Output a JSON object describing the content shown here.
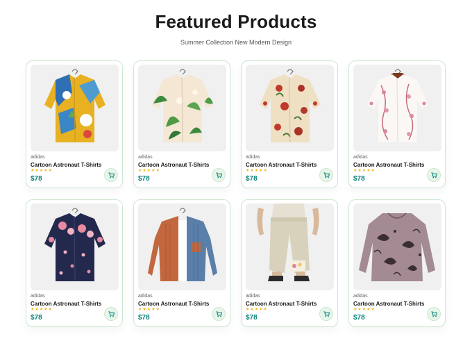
{
  "header": {
    "title": "Featured Products",
    "subtitle": "Summer Collection New Modern Design"
  },
  "products": [
    {
      "brand": "adidas",
      "name": "Cartoon Astronaut T-Shirts",
      "stars": "★★★★★",
      "price": "$78",
      "image": "shirt-yellow-blue-print"
    },
    {
      "brand": "adidas",
      "name": "Cartoon Astronaut T-Shirts",
      "stars": "★★★★★",
      "price": "$78",
      "image": "shirt-tropical-leaves"
    },
    {
      "brand": "adidas",
      "name": "Cartoon Astronaut T-Shirts",
      "stars": "★★★★★",
      "price": "$78",
      "image": "shirt-floral-beige-red"
    },
    {
      "brand": "adidas",
      "name": "Cartoon Astronaut T-Shirts",
      "stars": "★★★★★",
      "price": "$78",
      "image": "shirt-white-pink-floral"
    },
    {
      "brand": "adidas",
      "name": "Cartoon Astronaut T-Shirts",
      "stars": "★★★★★",
      "price": "$78",
      "image": "shirt-navy-pink-floral"
    },
    {
      "brand": "adidas",
      "name": "Cartoon Astronaut T-Shirts",
      "stars": "★★★★★",
      "price": "$78",
      "image": "jacket-rust-denim"
    },
    {
      "brand": "adidas",
      "name": "Cartoon Astronaut T-Shirts",
      "stars": "★★★★★",
      "price": "$78",
      "image": "linen-pants-floral-patch"
    },
    {
      "brand": "adidas",
      "name": "Cartoon Astronaut T-Shirts",
      "stars": "★★★★★",
      "price": "$78",
      "image": "blouse-mauve-paisley"
    }
  ],
  "colors": {
    "accent": "#088178",
    "star": "#f3b519",
    "cart_bg": "#e8f6ea",
    "card_border": "#cce7d0"
  },
  "icons": {
    "cart": "cart-icon",
    "hanger": "hanger-icon"
  }
}
